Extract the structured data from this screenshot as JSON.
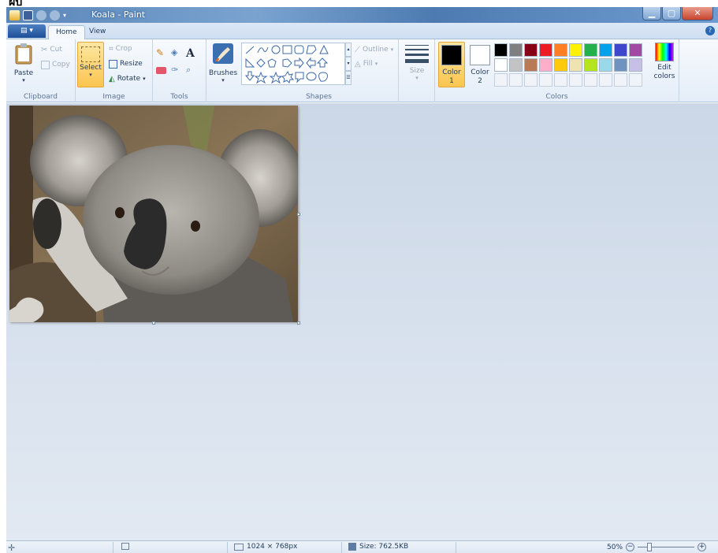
{
  "stray_text": "ฝ้ป",
  "window": {
    "title": "Koala - Paint"
  },
  "menu": {
    "app_button": "▤ ▾",
    "tabs": [
      "Home",
      "View"
    ],
    "help": "?"
  },
  "ribbon": {
    "clipboard": {
      "label": "Clipboard",
      "paste": "Paste",
      "cut": "Cut",
      "copy": "Copy"
    },
    "image": {
      "label": "Image",
      "select": "Select",
      "crop": "Crop",
      "resize": "Resize",
      "rotate": "Rotate"
    },
    "tools": {
      "label": "Tools",
      "text_tool": "A"
    },
    "brushes": {
      "label": "Brushes"
    },
    "shapes": {
      "label": "Shapes",
      "outline": "Outline",
      "fill": "Fill"
    },
    "size": {
      "label": "Size"
    },
    "colors": {
      "label": "Colors",
      "color1_label": "Color",
      "color1_num": "1",
      "color2_label": "Color",
      "color2_num": "2",
      "edit_colors_line1": "Edit",
      "edit_colors_line2": "colors",
      "color1_value": "#000000",
      "color2_value": "#ffffff",
      "palette_row1": [
        "#000000",
        "#7f7f7f",
        "#880015",
        "#ed1c24",
        "#ff7f27",
        "#fff200",
        "#22b14c",
        "#00a2e8",
        "#3f48cc",
        "#a349a4"
      ],
      "palette_row2": [
        "#ffffff",
        "#c3c3c3",
        "#b97a57",
        "#ffaec9",
        "#ffc90e",
        "#efe4b0",
        "#b5e61d",
        "#99d9ea",
        "#7092be",
        "#c8bfe7"
      ]
    }
  },
  "status": {
    "dimensions": "1024 × 768px",
    "size": "Size: 762.5KB",
    "zoom": "50%"
  }
}
